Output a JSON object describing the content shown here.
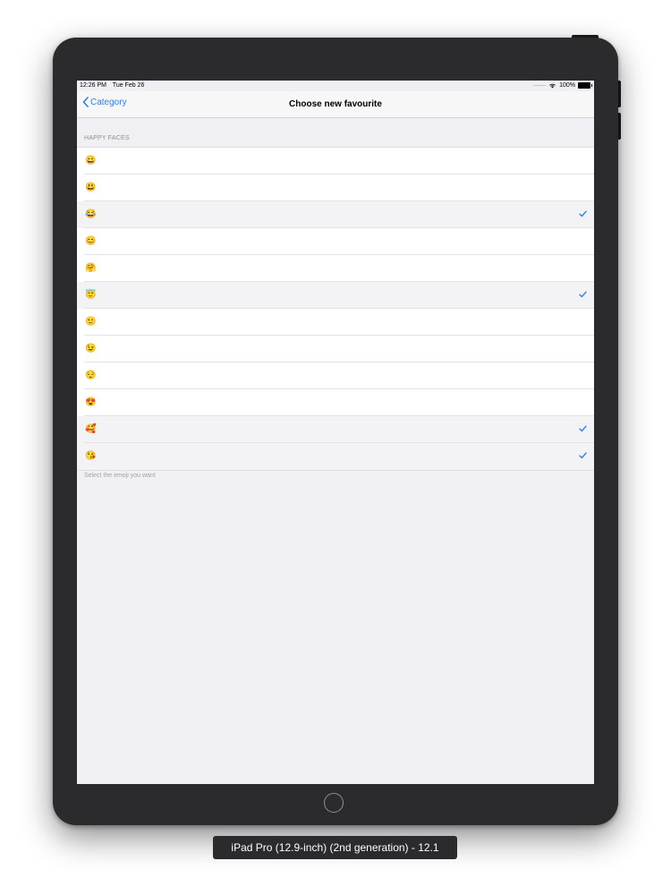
{
  "status_bar": {
    "time": "12:26 PM",
    "date": "Tue Feb 26",
    "battery": "100%"
  },
  "nav": {
    "back_label": "Category",
    "title": "Choose new favourite"
  },
  "section": {
    "header": "HAPPY FACES",
    "footer": "Select the emoji you want"
  },
  "rows": [
    {
      "emoji": "😀",
      "selected": false
    },
    {
      "emoji": "😃",
      "selected": false
    },
    {
      "emoji": "😂",
      "selected": true
    },
    {
      "emoji": "😊",
      "selected": false
    },
    {
      "emoji": "🤗",
      "selected": false
    },
    {
      "emoji": "😇",
      "selected": true
    },
    {
      "emoji": "🙂",
      "selected": false
    },
    {
      "emoji": "😉",
      "selected": false
    },
    {
      "emoji": "😌",
      "selected": false
    },
    {
      "emoji": "😍",
      "selected": false
    },
    {
      "emoji": "🥰",
      "selected": true
    },
    {
      "emoji": "😘",
      "selected": true
    }
  ],
  "simulator_label": "iPad Pro (12.9-inch) (2nd generation) - 12.1",
  "colors": {
    "accent": "#2f7ef6",
    "device_body": "#2b2b2d",
    "screen_background": "#efeff4"
  }
}
